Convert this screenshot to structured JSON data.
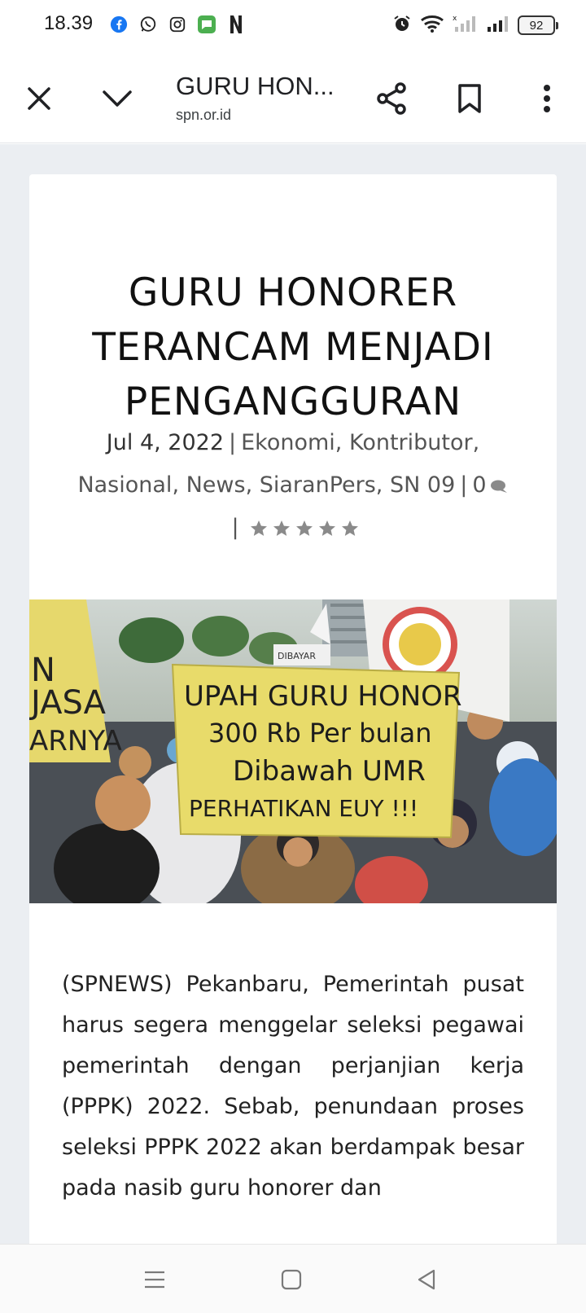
{
  "status": {
    "time": "18.39",
    "battery": "92",
    "app_icons": [
      "facebook-icon",
      "whatsapp-icon",
      "instagram-icon",
      "chat-app-icon",
      "netflix-icon"
    ],
    "right_icons": [
      "alarm-icon",
      "wifi-icon",
      "signal-icon-1",
      "signal-icon-2"
    ]
  },
  "toolbar": {
    "title": "GURU HON...",
    "domain": "spn.or.id"
  },
  "article": {
    "headline_lines": [
      "GURU HONORER",
      "TERANCAM MENJADI",
      "PENGANGGURAN"
    ],
    "date": "Jul 4, 2022",
    "categories": [
      "Ekonomi",
      "Kontributor",
      "Nasional",
      "News",
      "SiaranPers",
      "SN 09"
    ],
    "comment_count": "0",
    "rating_stars": 5,
    "hero_sign": [
      "UPAH GURU HONOR",
      "300 Rb Per bulan",
      "Dibawah UMR",
      "PERHATIKAN EUY !!!"
    ],
    "hero_left_sign": [
      "N",
      "JASA",
      "ARNYA"
    ],
    "hero_small_sign": "DIBAYAR",
    "body": "(SPNEWS) Pekanbaru, Pemerintah pusat harus segera menggelar seleksi pegawai pemerintah dengan perjanjian kerja (PPPK) 2022. Sebab, penundaan proses seleksi PPPK 2022 akan berdampak besar pada nasib guru honorer dan"
  },
  "colors": {
    "page_bg": "#ebeef2",
    "card_bg": "#ffffff",
    "text": "#111111",
    "meta": "#555555",
    "star": "#8a8a8a",
    "sign_yellow": "#e8db6a"
  }
}
